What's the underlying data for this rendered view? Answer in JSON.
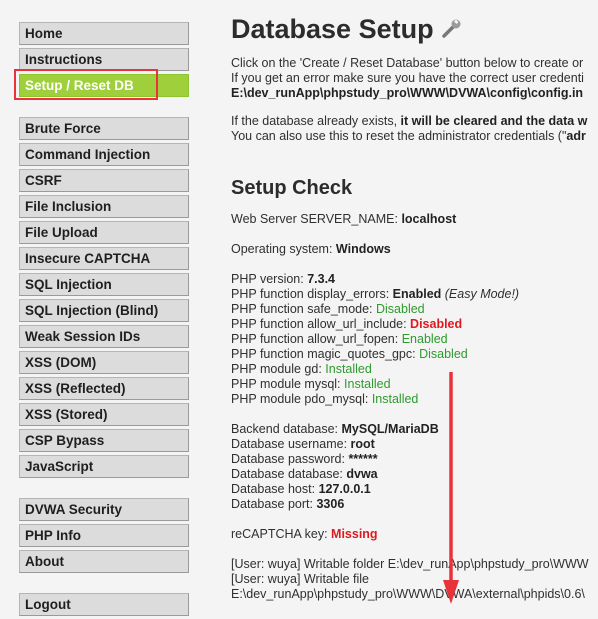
{
  "sidebar": {
    "group1": [
      {
        "label": "Home",
        "selected": false
      },
      {
        "label": "Instructions",
        "selected": false
      },
      {
        "label": "Setup / Reset DB",
        "selected": true
      }
    ],
    "group2": [
      {
        "label": "Brute Force"
      },
      {
        "label": "Command Injection"
      },
      {
        "label": "CSRF"
      },
      {
        "label": "File Inclusion"
      },
      {
        "label": "File Upload"
      },
      {
        "label": "Insecure CAPTCHA"
      },
      {
        "label": "SQL Injection"
      },
      {
        "label": "SQL Injection (Blind)"
      },
      {
        "label": "Weak Session IDs"
      },
      {
        "label": "XSS (DOM)"
      },
      {
        "label": "XSS (Reflected)"
      },
      {
        "label": "XSS (Stored)"
      },
      {
        "label": "CSP Bypass"
      },
      {
        "label": "JavaScript"
      }
    ],
    "group3": [
      {
        "label": "DVWA Security"
      },
      {
        "label": "PHP Info"
      },
      {
        "label": "About"
      }
    ],
    "group4": [
      {
        "label": "Logout"
      }
    ]
  },
  "main": {
    "title": "Database Setup",
    "title_icon": "wrench-icon",
    "intro": {
      "line1": "Click on the 'Create / Reset Database' button below to create or",
      "line2": "If you get an error make sure you have the correct user credenti",
      "path": "E:\\dev_runApp\\phpstudy_pro\\WWW\\DVWA\\config\\config.in",
      "line4_a": "If the database already exists, ",
      "line4_b": "it will be cleared and the data w",
      "line5_a": "You can also use this to reset the administrator credentials (\"",
      "line5_b": "adr"
    },
    "setup_check_heading": "Setup Check",
    "server_name": {
      "label": "Web Server SERVER_NAME: ",
      "value": "localhost"
    },
    "os": {
      "label": "Operating system: ",
      "value": "Windows"
    },
    "php_version": {
      "label": "PHP version: ",
      "value": "7.3.4"
    },
    "display_errors": {
      "label": "PHP function display_errors: ",
      "value": "Enabled",
      "note": "(Easy Mode!)"
    },
    "safe_mode": {
      "label": "PHP function safe_mode: ",
      "value": "Disabled"
    },
    "allow_url_include": {
      "label": "PHP function allow_url_include: ",
      "value": "Disabled"
    },
    "allow_url_fopen": {
      "label": "PHP function allow_url_fopen: ",
      "value": "Enabled"
    },
    "magic_quotes": {
      "label": "PHP function magic_quotes_gpc: ",
      "value": "Disabled"
    },
    "module_gd": {
      "label": "PHP module gd: ",
      "value": "Installed"
    },
    "module_mysql": {
      "label": "PHP module mysql: ",
      "value": "Installed"
    },
    "module_pdo": {
      "label": "PHP module pdo_mysql: ",
      "value": "Installed"
    },
    "db_backend": {
      "label": "Backend database: ",
      "value": "MySQL/MariaDB"
    },
    "db_user": {
      "label": "Database username: ",
      "value": "root"
    },
    "db_pass": {
      "label": "Database password: ",
      "value": "******"
    },
    "db_name": {
      "label": "Database database: ",
      "value": "dvwa"
    },
    "db_host": {
      "label": "Database host: ",
      "value": "127.0.0.1"
    },
    "db_port": {
      "label": "Database port: ",
      "value": "3306"
    },
    "recaptcha": {
      "label": "reCAPTCHA key: ",
      "value": "Missing"
    },
    "writable1": "[User: wuya] Writable folder E:\\dev_runApp\\phpstudy_pro\\WWW",
    "writable2": "[User: wuya] Writable file",
    "writable3": "E:\\dev_runApp\\phpstudy_pro\\WWW\\DVWA\\external\\phpids\\0.6\\"
  },
  "colors": {
    "selected_menu": "#9fd03c",
    "highlight_box": "#e8333a",
    "status_green": "#2e9a2e",
    "status_red": "#e0191f",
    "annotation_arrow": "#e8333a"
  }
}
